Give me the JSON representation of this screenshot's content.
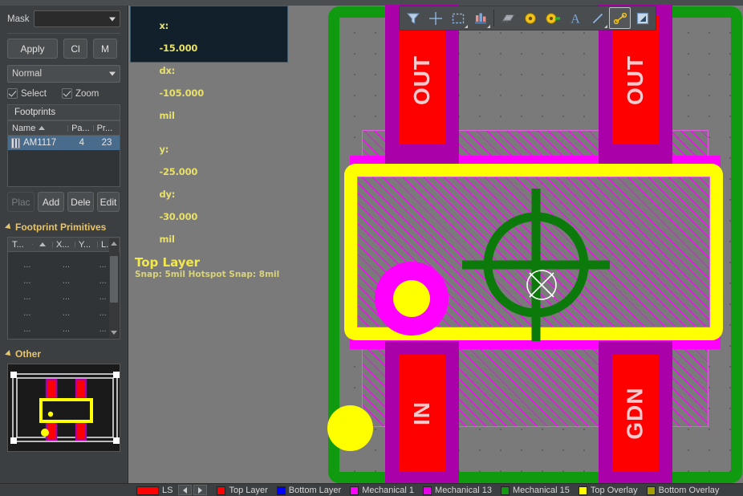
{
  "sidebar": {
    "mask": {
      "label": "Mask",
      "value": "",
      "placeholder": ""
    },
    "buttons": {
      "apply": "Apply",
      "clear": "Cl",
      "magnify": "M"
    },
    "display_mode": "Normal",
    "checkboxes": [
      {
        "label": "Select",
        "checked": true
      },
      {
        "label": "Zoom",
        "checked": true
      }
    ],
    "footprints": {
      "title": "Footprints",
      "columns": [
        "Name",
        "Pa...",
        "Pr..."
      ],
      "sort_column": "Name",
      "sort_direction": "asc",
      "rows": [
        {
          "icon": "chip-icon",
          "name": "AM1117",
          "pads": "4",
          "primitives": "23",
          "selected": true
        }
      ],
      "actions": [
        {
          "label": "Plac",
          "enabled": false
        },
        {
          "label": "Add",
          "enabled": true
        },
        {
          "label": "Dele",
          "enabled": true
        },
        {
          "label": "Edit",
          "enabled": true
        }
      ]
    },
    "primitives": {
      "title": "Footprint Primitives",
      "expanded": true,
      "columns": [
        "T...",
        "X...",
        "Y...",
        "L..."
      ],
      "sort_direction": "asc",
      "rows": [
        [
          "...",
          "...",
          "..."
        ],
        [
          "...",
          "...",
          "..."
        ],
        [
          "...",
          "...",
          "..."
        ],
        [
          "...",
          "...",
          "..."
        ],
        [
          "...",
          "...",
          "..."
        ]
      ]
    },
    "other": {
      "title": "Other",
      "expanded": true
    }
  },
  "status": {
    "x_label": "x:",
    "x_value": "-15.000",
    "dx_label": "dx:",
    "dx_value": "-105.000",
    "x_unit": "mil",
    "y_label": "y:",
    "y_value": "-25.000",
    "dy_label": "dy:",
    "dy_value": "-30.000",
    "y_unit": "mil",
    "layer": "Top Layer",
    "snap": "Snap: 5mil Hotspot Snap: 8mil"
  },
  "toolbar": {
    "items": [
      {
        "name": "filter-icon",
        "label": "Filter",
        "active": false,
        "dropdown": false
      },
      {
        "name": "crosshair-placement-icon",
        "label": "Placement Crosshair",
        "active": false,
        "dropdown": false
      },
      {
        "name": "marquee-select-icon",
        "label": "Area Select",
        "active": false,
        "dropdown": true
      },
      {
        "name": "align-bars-icon",
        "label": "Align",
        "active": false,
        "dropdown": true
      },
      {
        "name": "ic-chip-icon",
        "label": "Place Component",
        "active": false,
        "dropdown": false
      },
      {
        "name": "via-icon",
        "label": "Place Via",
        "active": false,
        "dropdown": false
      },
      {
        "name": "pad-icon",
        "label": "Place Pad",
        "active": false,
        "dropdown": false
      },
      {
        "name": "text-icon",
        "label": "Place String",
        "active": false,
        "dropdown": false
      },
      {
        "name": "line-icon",
        "label": "Place Line",
        "active": false,
        "dropdown": true
      },
      {
        "name": "dimension-icon",
        "label": "Place Dimension",
        "active": true,
        "dropdown": true
      },
      {
        "name": "fill-icon",
        "label": "Place Fill",
        "active": false,
        "dropdown": false
      }
    ]
  },
  "canvas": {
    "background_color": "#7a7a7a",
    "board_outline_color": "#0f9a0f",
    "pad_fill_color": "#ff0000",
    "pad_ring_color": "#aa00aa",
    "overlay_color": "#ffff00",
    "mech_layer_color": "#ff00ff",
    "pads": [
      {
        "label": "OUT",
        "position": "top-left"
      },
      {
        "label": "OUT",
        "position": "top-right"
      },
      {
        "label": "IN",
        "position": "bottom-left"
      },
      {
        "label": "GDN",
        "position": "bottom-right"
      }
    ],
    "origin_marker": "origin-crosshair",
    "cursor_marker": "snap-cursor"
  },
  "bottom_bar": {
    "nav_prev": "◀",
    "nav_next": "▶",
    "lf_label": "LS",
    "lf_color": "#ff0000",
    "layers": [
      {
        "label": "Top Layer",
        "color": "#ff0000"
      },
      {
        "label": "Bottom Layer",
        "color": "#0000ff"
      },
      {
        "label": "Mechanical 1",
        "color": "#ff00ff"
      },
      {
        "label": "Mechanical 13",
        "color": "#e800e8"
      },
      {
        "label": "Mechanical 15",
        "color": "#0f9a0f"
      },
      {
        "label": "Top Overlay",
        "color": "#ffff00"
      },
      {
        "label": "Bottom Overlay",
        "color": "#a0a000"
      }
    ]
  }
}
